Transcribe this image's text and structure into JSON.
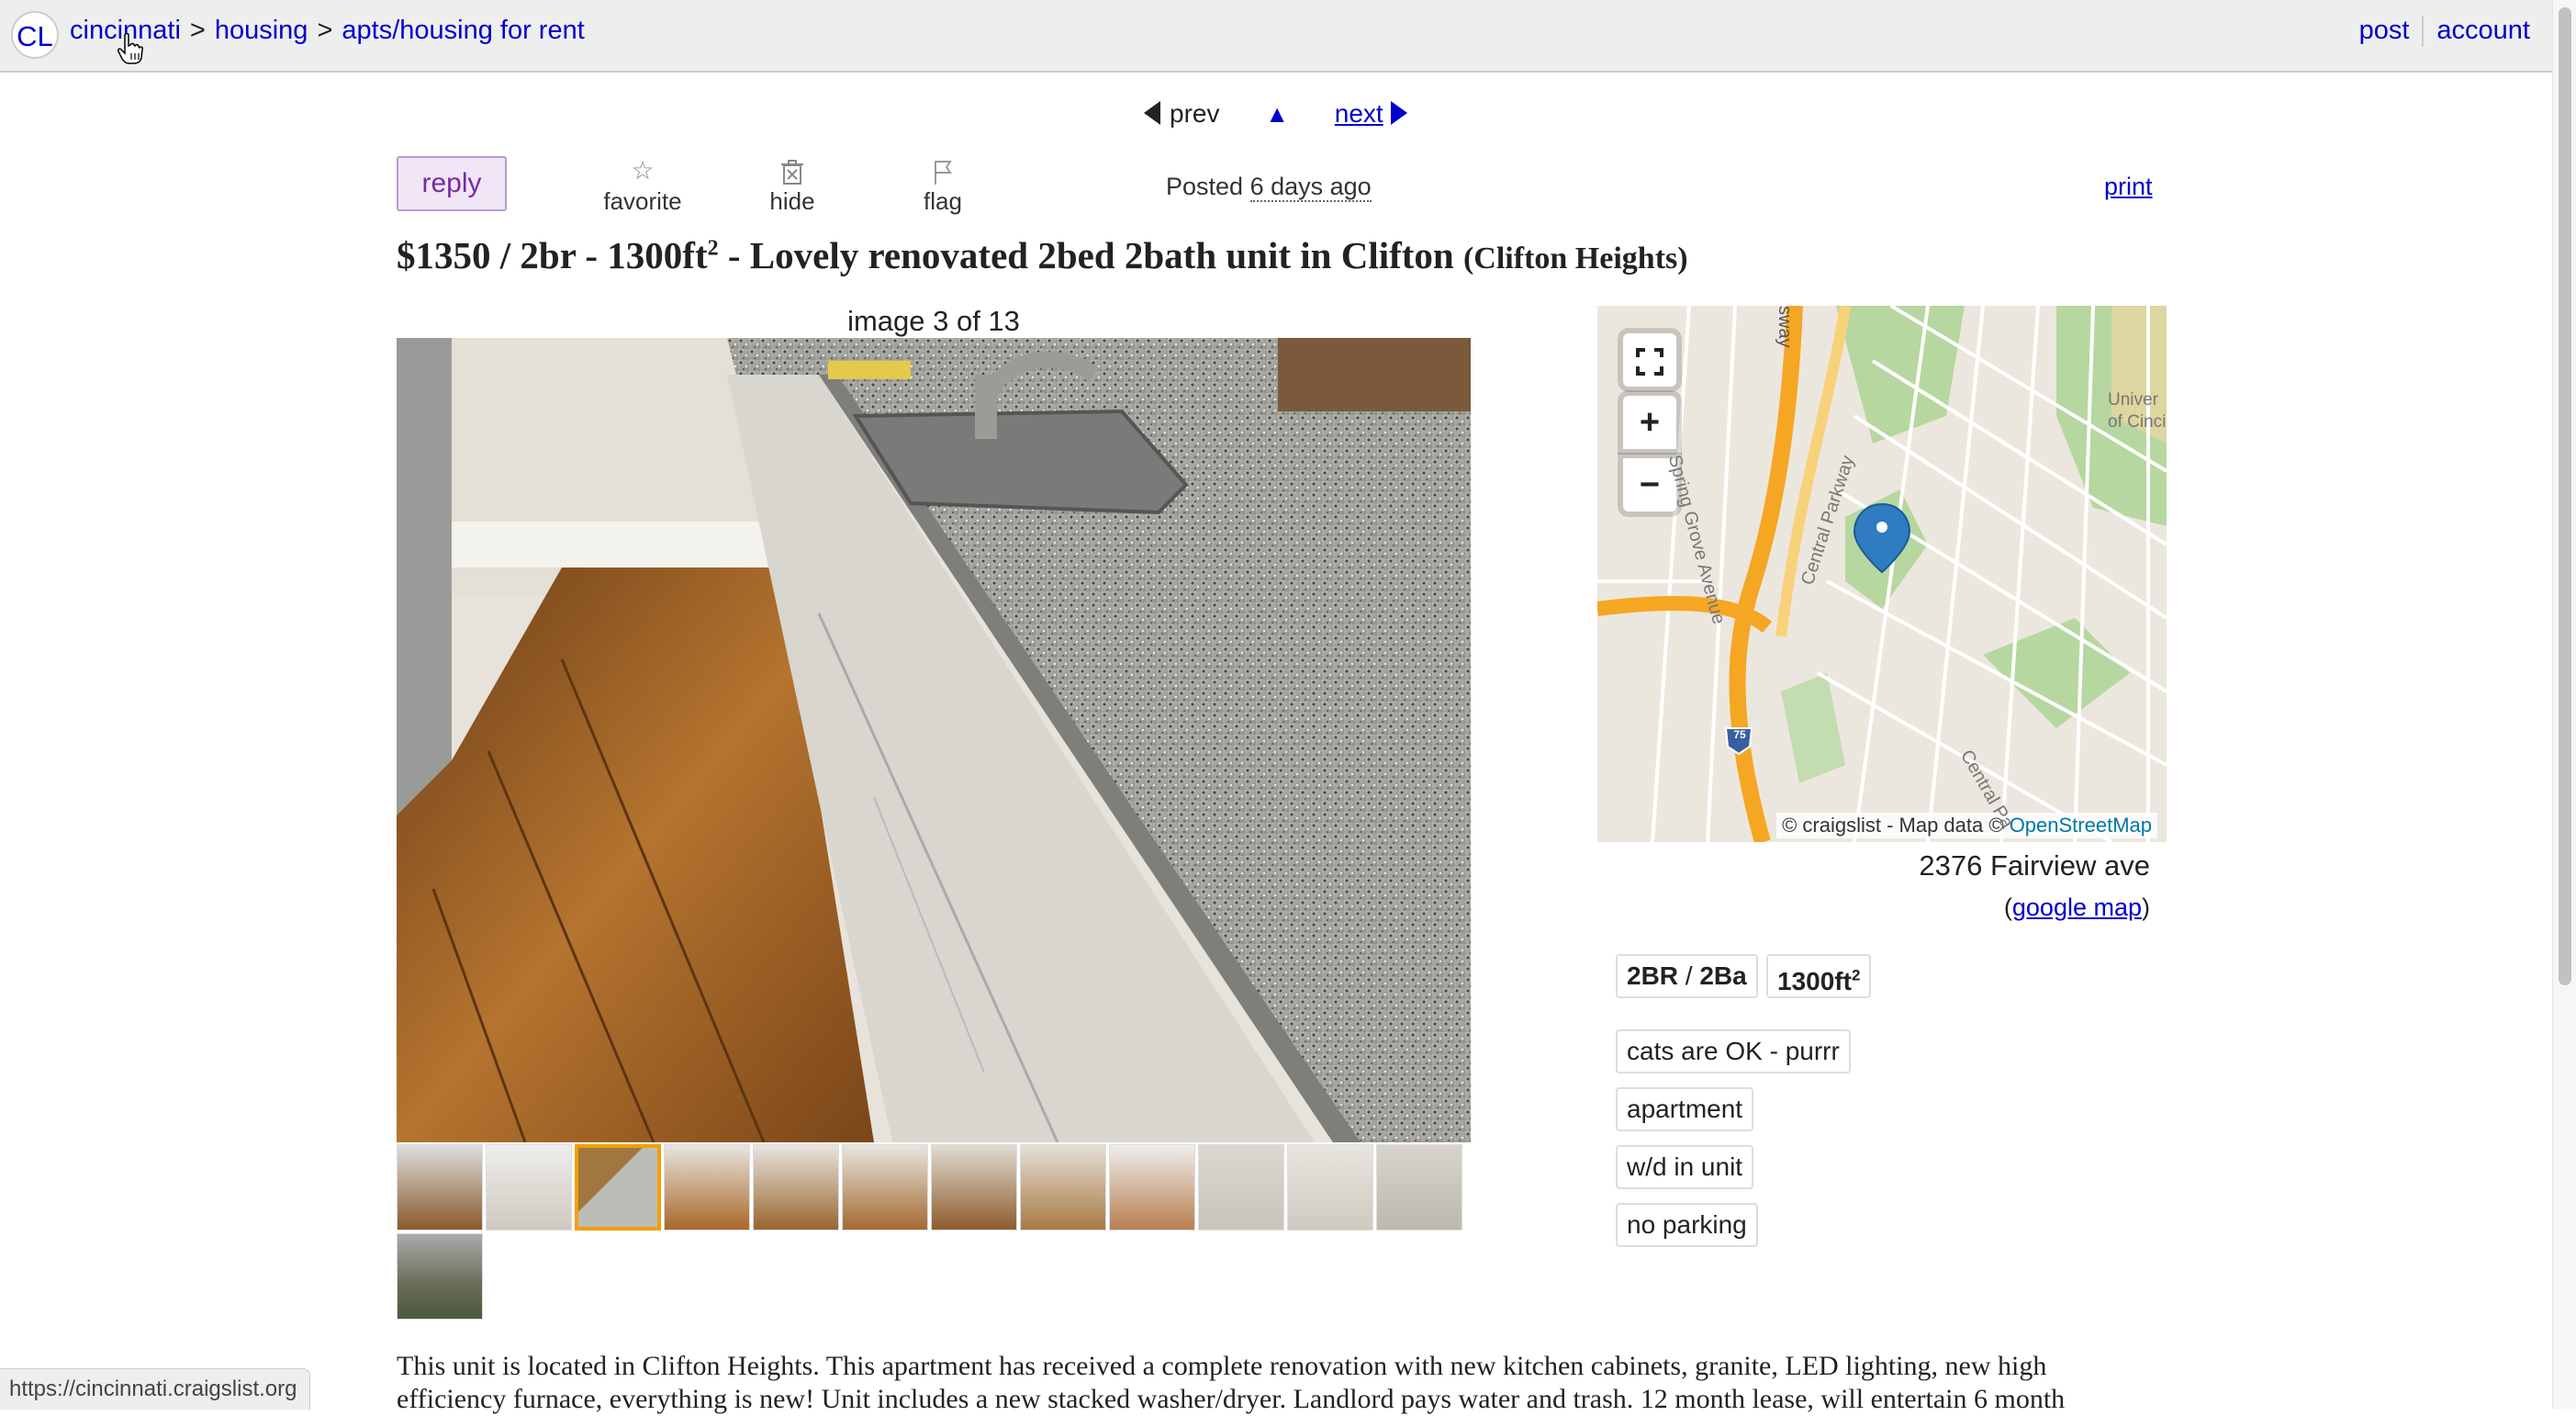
{
  "header": {
    "logo": "CL",
    "breadcrumbs": [
      "cincinnati",
      "housing",
      "apts/housing for rent"
    ],
    "separator": ">",
    "post_label": "post",
    "account_label": "account"
  },
  "nav": {
    "prev_label": "prev",
    "up_label": "▲",
    "next_label": "next"
  },
  "actions": {
    "reply_label": "reply",
    "favorite_label": "favorite",
    "hide_label": "hide",
    "flag_label": "flag",
    "posted_prefix": "Posted",
    "posted_date": "6 days ago",
    "print_label": "print"
  },
  "listing": {
    "title_main": "$1350 / 2br - 1300ft",
    "title_sup": "2",
    "title_rest": " - Lovely renovated 2bed 2bath unit in Clifton ",
    "neighborhood": "(Clifton Heights)"
  },
  "gallery": {
    "counter": "image 3 of 13",
    "thumb_count": 13,
    "selected_thumb": 3
  },
  "map": {
    "credit_prefix": "© craigslist - Map data ©",
    "credit_link": "OpenStreetMap",
    "street_labels": [
      "Spring Grove Avenue",
      "Central Parkway",
      "Central Pa",
      "sway",
      "Univer",
      "of Cinci"
    ],
    "highway_shield": "75",
    "address": "2376 Fairview ave",
    "google_map_label": "google map"
  },
  "attributes": {
    "br": "2BR",
    "ba": "2Ba",
    "sqft": "1300ft",
    "sqft_sup": "2",
    "tags": [
      "cats are OK - purrr",
      "apartment",
      "w/d in unit",
      "no parking"
    ]
  },
  "body": {
    "text": "This unit is located in Clifton Heights. This apartment has received a complete renovation with new kitchen cabinets, granite, LED lighting, new high efficiency furnace, everything is new! Unit includes a new stacked washer/dryer. Landlord pays water and trash. 12 month lease, will entertain 6 month"
  },
  "status_bar": {
    "url": "https://cincinnati.craigslist.org"
  }
}
